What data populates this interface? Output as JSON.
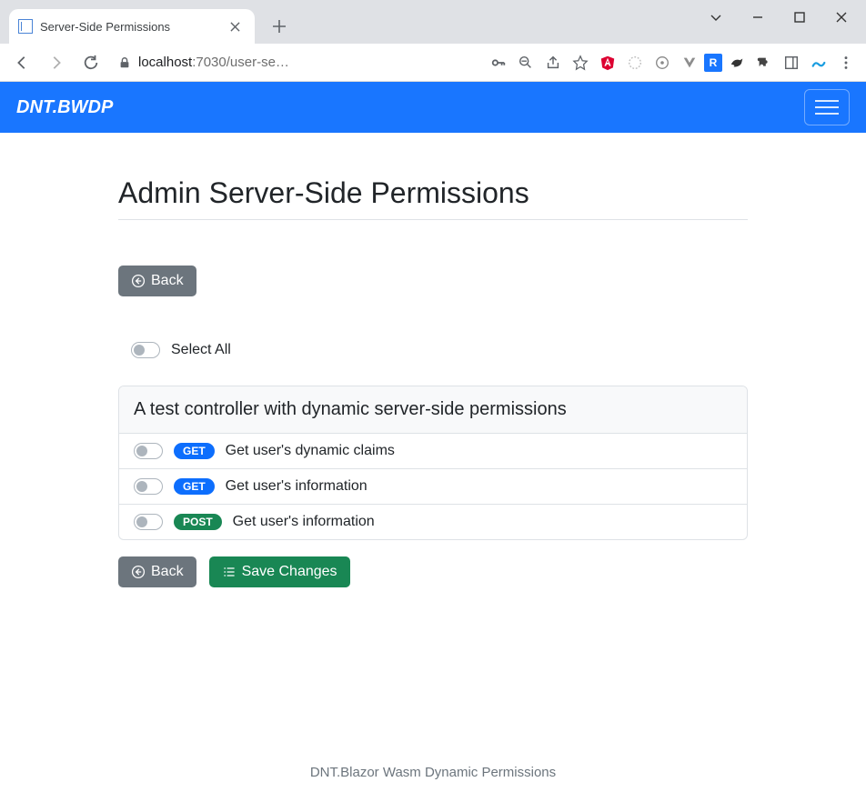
{
  "window": {
    "tab_title": "Server-Side Permissions",
    "url_host": "localhost",
    "url_port": ":7030",
    "url_path": "/user-se…"
  },
  "nav": {
    "brand": "DNT.BWDP"
  },
  "page": {
    "title": "Admin Server-Side Permissions",
    "back_label": "Back",
    "select_all_label": "Select All",
    "save_label": "Save Changes"
  },
  "controller": {
    "header": "A test controller with dynamic server-side permissions",
    "rows": [
      {
        "method": "GET",
        "label": "Get user's dynamic claims"
      },
      {
        "method": "GET",
        "label": "Get user's information"
      },
      {
        "method": "POST",
        "label": "Get user's information"
      }
    ]
  },
  "footer": "DNT.Blazor Wasm Dynamic Permissions"
}
